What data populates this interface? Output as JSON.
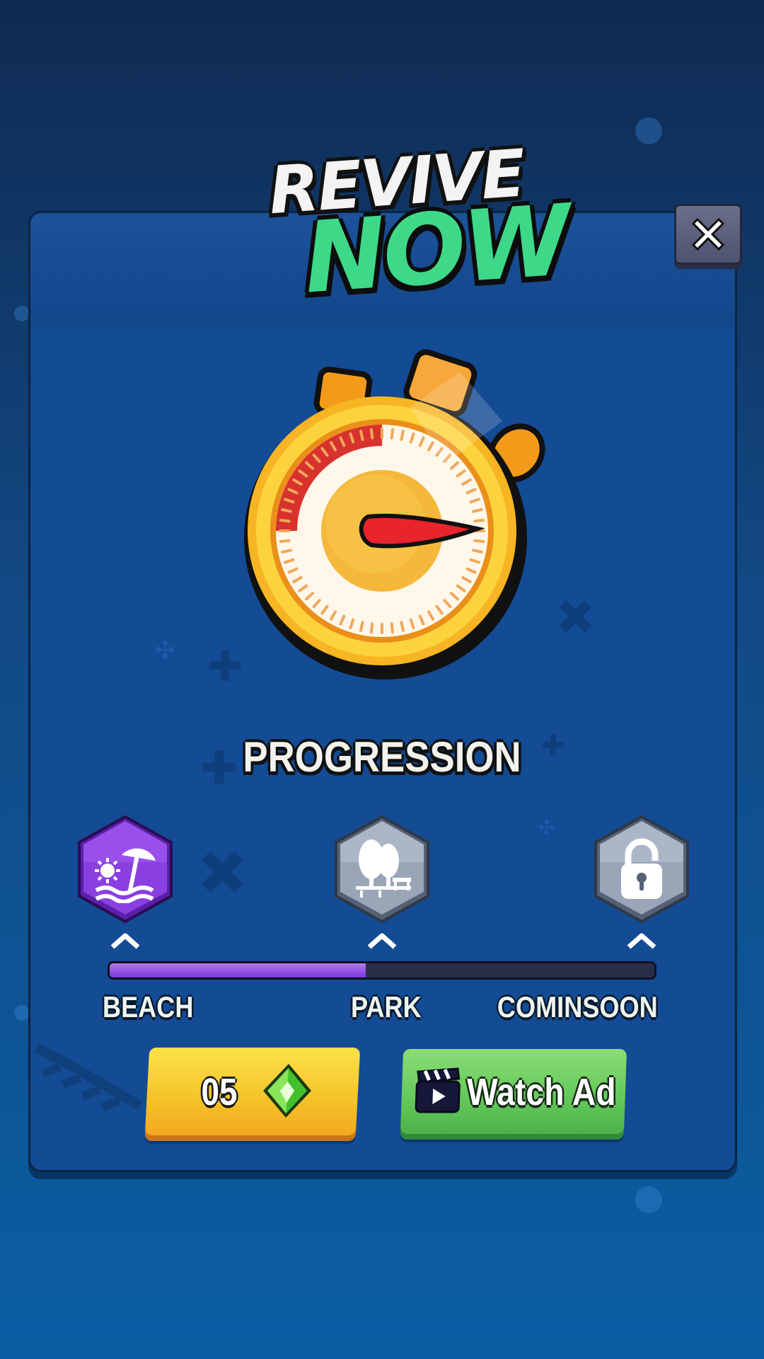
{
  "title": {
    "line1": "REVIVE",
    "line2": "NOW"
  },
  "close_button": {
    "icon": "close-icon"
  },
  "timer": {
    "icon": "stopwatch-icon",
    "elapsed_fraction": 0.25
  },
  "progression": {
    "title": "PROGRESSION",
    "progress_fraction": 0.47,
    "levels": [
      {
        "label": "BEACH",
        "icon": "beach-umbrella-icon",
        "state": "active",
        "color": "#8a3fe0"
      },
      {
        "label": "PARK",
        "icon": "trees-icon",
        "state": "locked",
        "color": "#9aa6b8"
      },
      {
        "label": "COMINSOON",
        "icon": "lock-icon",
        "state": "locked",
        "color": "#9aa6b8"
      }
    ]
  },
  "actions": {
    "gem_button": {
      "count": "05",
      "icon": "green-gem-icon",
      "color": "#f5c52b"
    },
    "watch_ad_button": {
      "label": "Watch Ad",
      "icon": "clapperboard-icon",
      "color": "#63c85a"
    }
  },
  "colors": {
    "background": "#124a86",
    "panel": "#134b95",
    "title_accent": "#3ed889",
    "progress_fill": "#8f4fe6"
  }
}
